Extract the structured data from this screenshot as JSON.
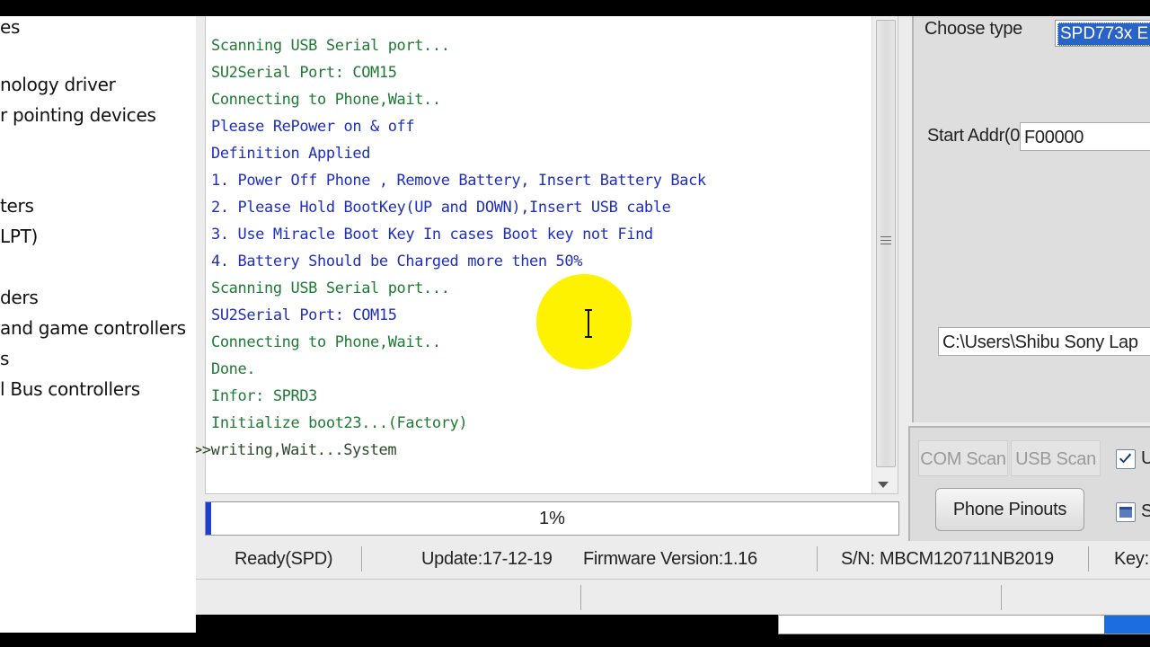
{
  "device_manager": {
    "items": [
      "es",
      "nology driver",
      "r pointing devices",
      "ters",
      " LPT)",
      "ders",
      "and game controllers",
      "s",
      "l Bus controllers"
    ]
  },
  "log": {
    "lines": [
      {
        "text": "Scanning USB Serial port...",
        "color": "green"
      },
      {
        "text": "SU2Serial Port: COM15",
        "color": "green"
      },
      {
        "text": "Connecting to Phone,Wait..",
        "color": "green"
      },
      {
        "text": "Please RePower on & off",
        "color": "blue"
      },
      {
        "text": "Definition Applied",
        "color": "blue"
      },
      {
        "text": "1. Power Off Phone , Remove Battery, Insert Battery Back",
        "color": "blue"
      },
      {
        "text": "2. Please Hold BootKey(UP and DOWN),Insert USB cable",
        "color": "blue"
      },
      {
        "text": "3. Use Miracle Boot Key In cases Boot key not Find",
        "color": "blue"
      },
      {
        "text": "4. Battery Should be Charged more then 50%",
        "color": "blue"
      },
      {
        "text": "Scanning USB Serial port...",
        "color": "green"
      },
      {
        "text": "SU2Serial Port: COM15",
        "color": "blue"
      },
      {
        "text": "Connecting to Phone,Wait..",
        "color": "green"
      },
      {
        "text": "Done.",
        "color": "green"
      },
      {
        "text": "Infor: SPRD3",
        "color": "green"
      },
      {
        "text": "Initialize boot23...(Factory)",
        "color": "green"
      },
      {
        "text": ">>writing,Wait...System",
        "color": "dark"
      }
    ]
  },
  "progress": {
    "label": "1%",
    "value": 0.01
  },
  "statusbar": {
    "ready": "Ready(SPD)",
    "update": "Update:17-12-19",
    "firmware": "Firmware Version:1.16",
    "serial": "S/N: MBCM120711NB2019",
    "key": "Key:"
  },
  "right_panel": {
    "choose_type_label": "Choose type",
    "choose_type_value": "SPD773x E",
    "start_addr_label": "Start Addr(0",
    "start_addr_value": "F00000",
    "path_value": "C:\\Users\\Shibu Sony Lap",
    "com_scan": "COM Scan",
    "usb_scan": "USB Scan",
    "check1_label": "U",
    "check2_label": "S",
    "phone_pinouts": "Phone Pinouts"
  },
  "colors": {
    "log_green": "#1f7a35",
    "log_blue": "#1f2fb8",
    "progress_fill": "#1a3fd6",
    "highlight": "#fff200",
    "selection": "#2a63c8"
  }
}
